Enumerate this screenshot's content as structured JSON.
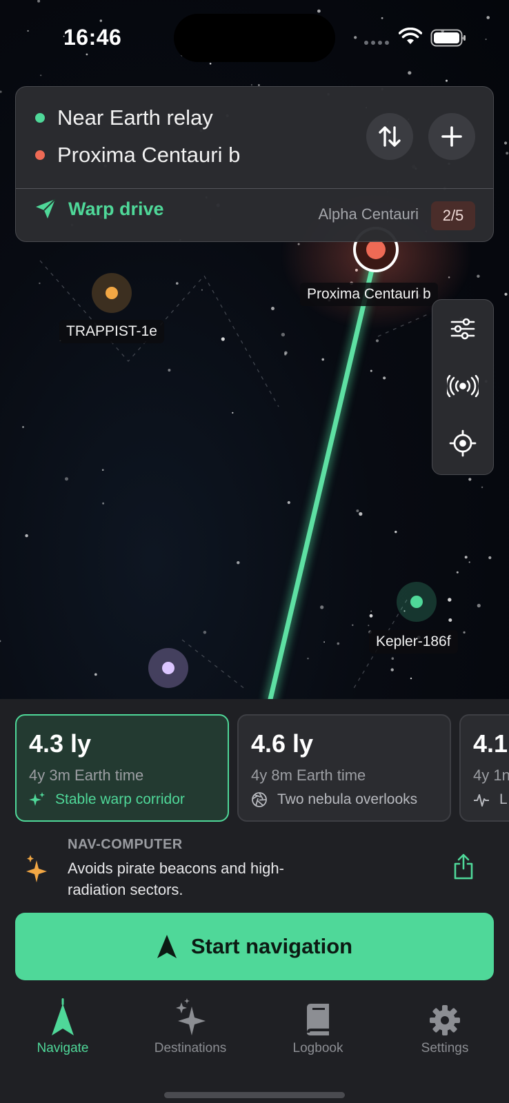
{
  "status_bar": {
    "time": "16:46"
  },
  "route": {
    "origin": "Near Earth relay",
    "destination": "Proxima Centauri b",
    "mode": "Warp drive",
    "region": "Alpha Centauri",
    "count_badge": "2/5",
    "icons": {
      "swap": "swap-vertical-icon",
      "add": "plus-icon",
      "mode": "paper-plane-icon"
    },
    "colors": {
      "origin_dot": "#4fd899",
      "destination_dot": "#ee6a55"
    }
  },
  "map": {
    "planets": [
      {
        "name": "Proxima Centauri b",
        "color": "#ee6a55"
      },
      {
        "name": "TRAPPIST-1e",
        "color": "#f2a744"
      },
      {
        "name": "Kepler-186f",
        "color": "#4fd899"
      },
      {
        "name": "",
        "color": "#c8a8f5"
      }
    ],
    "tools": [
      "sliders-icon",
      "broadcast-icon",
      "crosshair-icon"
    ],
    "route_color": "#4fd899"
  },
  "route_options": [
    {
      "distance": "4.3 ly",
      "time": "4y 3m Earth time",
      "note": "Stable warp corridor",
      "icon": "sparkle-icon",
      "selected": true
    },
    {
      "distance": "4.6 ly",
      "time": "4y 8m Earth time",
      "note": "Two nebula overlooks",
      "icon": "aperture-icon",
      "selected": false
    },
    {
      "distance": "4.1",
      "time": "4y 1n",
      "note": "L",
      "icon": "pulse-icon",
      "selected": false
    }
  ],
  "nav_computer": {
    "title": "NAV-COMPUTER",
    "text": "Avoids pirate beacons and high-radiation sectors.",
    "icon": "sparkles-icon",
    "share_icon": "share-icon"
  },
  "start_button": {
    "label": "Start navigation",
    "icon": "navigation-arrow-icon"
  },
  "tabs": [
    {
      "label": "Navigate",
      "icon": "navigate-icon",
      "active": true
    },
    {
      "label": "Destinations",
      "icon": "sparkles-icon",
      "active": false
    },
    {
      "label": "Logbook",
      "icon": "book-icon",
      "active": false
    },
    {
      "label": "Settings",
      "icon": "gear-icon",
      "active": false
    }
  ],
  "accent_color": "#4fd899"
}
